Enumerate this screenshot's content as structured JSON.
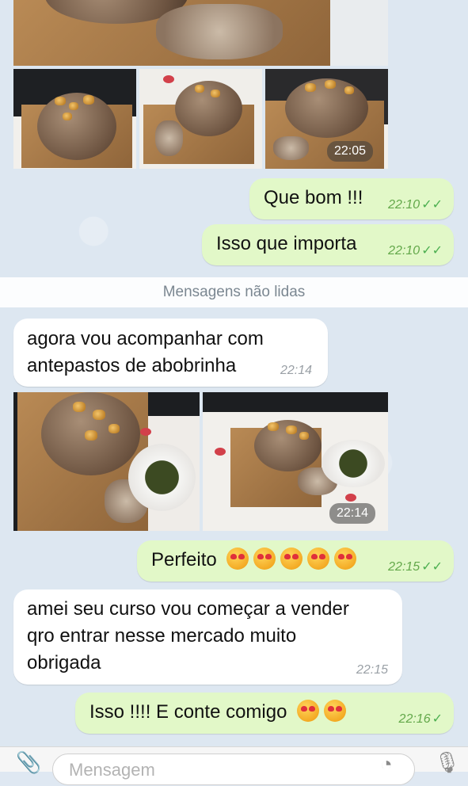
{
  "album_top": {
    "time": "22:05"
  },
  "messages": [
    {
      "id": "m1",
      "text": "Que bom !!!",
      "time": "22:10",
      "status": "read"
    },
    {
      "id": "m2",
      "text": "Isso que importa",
      "time": "22:10",
      "status": "read"
    },
    {
      "id": "m3",
      "text_line1": "agora vou acompanhar com",
      "text_line2": "antepastos de abobrinha",
      "time": "22:14"
    },
    {
      "id": "m4",
      "text": "Perfeito",
      "emoji_count": 5,
      "time": "22:15",
      "status": "read"
    },
    {
      "id": "m5",
      "text_line1": "amei seu curso vou começar a vender",
      "text_line2": "qro entrar nesse mercado  muito",
      "text_line3": "obrigada",
      "time": "22:15"
    },
    {
      "id": "m6",
      "text": "Isso !!!! E conte comigo",
      "emoji_count": 2,
      "time": "22:16",
      "status": "sent"
    }
  ],
  "album_mid": {
    "time": "22:14"
  },
  "divider": {
    "label": "Mensagens não lidas"
  },
  "input": {
    "placeholder": "Mensagem"
  },
  "icons": {
    "attach": "paperclip-icon",
    "sticker": "sticker-icon",
    "mic": "microphone-icon",
    "read": "double-check-icon",
    "sent": "check-icon"
  },
  "colors": {
    "outgoing_bubble": "#e2f8c8",
    "incoming_bubble": "#ffffff",
    "read_check": "#63a84a"
  }
}
